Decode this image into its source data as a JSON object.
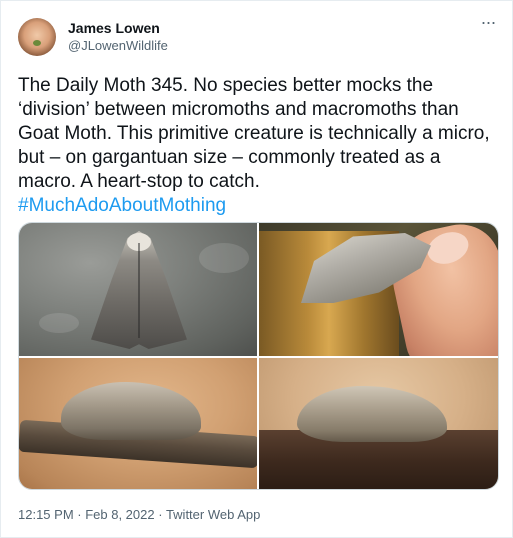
{
  "author": {
    "name": "James Lowen",
    "handle": "@JLowenWildlife"
  },
  "menu": {
    "more_label": "···"
  },
  "tweet": {
    "text": "The Daily Moth 345. No species better mocks the ‘division’ between micromoths and macromoths than Goat Moth. This primitive creature is technically a micro, but – on gargantuan size – commonly treated as a macro. A heart-stop to catch.",
    "hashtag": "#MuchAdoAboutMothing"
  },
  "media": {
    "photos": [
      "moth-on-rock",
      "moth-on-wood-with-finger",
      "moth-on-branch",
      "moth-on-bark"
    ]
  },
  "meta": {
    "time": "12:15 PM",
    "separator1": " · ",
    "date": "Feb 8, 2022",
    "separator2": " · ",
    "source": "Twitter Web App"
  },
  "colors": {
    "link": "#1d9bf0",
    "secondary_text": "#536471",
    "primary_text": "#0f1419",
    "border": "#cfd9de"
  }
}
